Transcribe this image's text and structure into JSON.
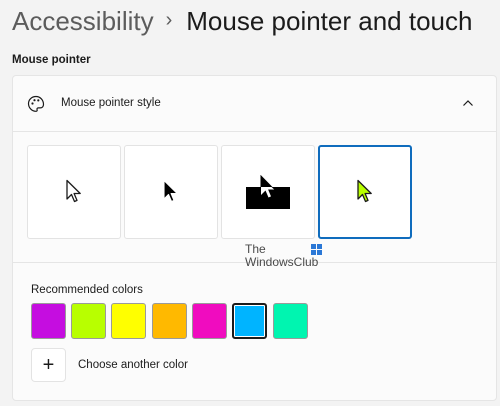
{
  "breadcrumb": {
    "parent": "Accessibility",
    "separator": "›",
    "current": "Mouse pointer and touch"
  },
  "section": {
    "title": "Mouse pointer"
  },
  "card": {
    "header_label": "Mouse pointer style",
    "header_icon": "palette-icon",
    "expand_icon": "chevron-up-icon"
  },
  "pointer_styles": [
    {
      "name": "white",
      "selected": false
    },
    {
      "name": "black",
      "selected": false
    },
    {
      "name": "inverted",
      "selected": false
    },
    {
      "name": "custom",
      "selected": true
    }
  ],
  "watermark": {
    "line1": "The",
    "line2": "WindowsClub"
  },
  "recommended_colors": {
    "label": "Recommended colors",
    "swatches": [
      "#c50de0",
      "#b8ff00",
      "#ffff00",
      "#ffb900",
      "#f00cbf",
      "#00b4ff",
      "#00f5b0"
    ],
    "selected_index": 5
  },
  "choose_color": {
    "icon": "+",
    "label": "Choose another color"
  },
  "colors": {
    "accent": "#0f6cbd",
    "custom_cursor": "#b8ff00"
  }
}
